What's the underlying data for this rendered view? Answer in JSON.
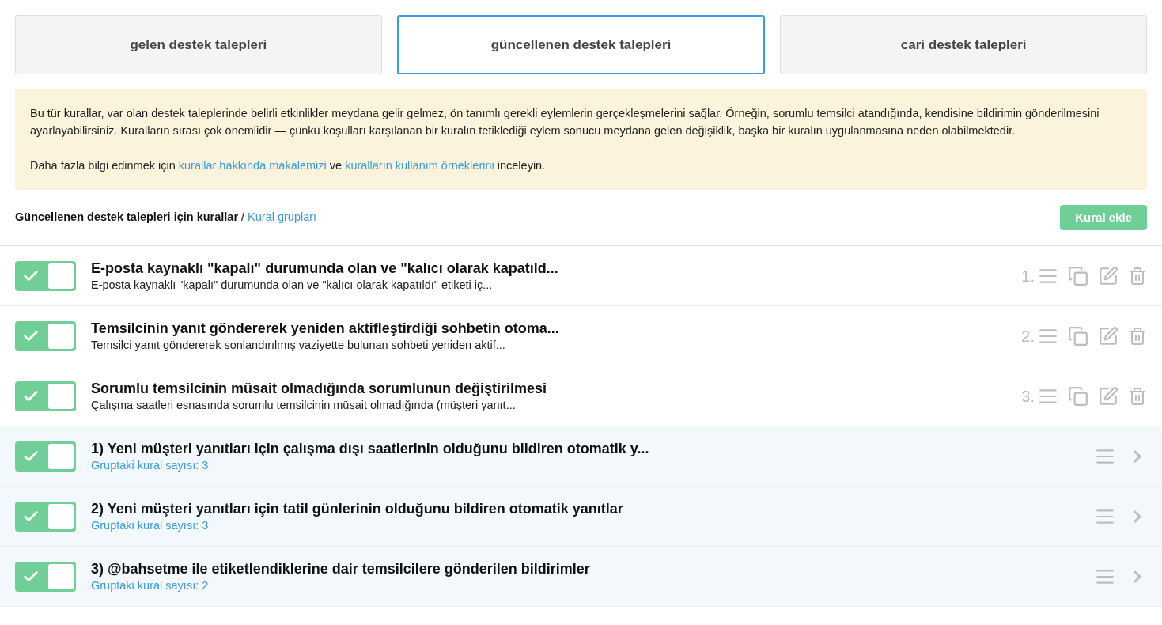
{
  "tabs": [
    {
      "label": "gelen destek talepleri",
      "selected": false
    },
    {
      "label": "güncellenen destek talepleri",
      "selected": true
    },
    {
      "label": "cari destek talepleri",
      "selected": false
    }
  ],
  "notice": {
    "paragraph": "Bu tür kurallar, var olan destek taleplerinde belirli etkinlikler meydana gelir gelmez, ön tanımlı gerekli eylemlerin gerçekleşmelerini sağlar. Örneğin, sorumlu temsilci atandığında, kendisine bildirimin gönderilmesini ayarlayabilirsiniz. Kuralların sırası çok önemlidir — çünkü koşulları karşılanan bir kuralın tetiklediği eylem sonucu meydana gelen değişiklik, başka bir kuralın uygulanmasına neden olabilmektedir.",
    "more": [
      {
        "kind": "text",
        "text": "Daha fazla bilgi edinmek için "
      },
      {
        "kind": "link",
        "text": "kurallar hakkında makalemizi"
      },
      {
        "kind": "text",
        "text": " ve "
      },
      {
        "kind": "link",
        "text": "kuralların kullanım örneklerini"
      },
      {
        "kind": "text",
        "text": " inceleyin."
      }
    ]
  },
  "breadcrumb": {
    "current": "Güncellenen destek talepleri için kurallar",
    "separator": "/",
    "link": "Kural grupları"
  },
  "add_button": "Kural ekle",
  "rules": [
    {
      "kind": "rule",
      "on": true,
      "title": "E-posta kaynaklı \"kapalı\" durumunda olan ve \"kalıcı olarak kapatıld...",
      "subtitle": "E-posta kaynaklı \"kapalı\" durumunda olan ve \"kalıcı olarak kapatıldı\" etiketi iç...",
      "order": "1."
    },
    {
      "kind": "rule",
      "on": true,
      "title": "Temsilcinin yanıt göndererek yeniden aktifleştirdiği sohbetin otoma...",
      "subtitle": "Temsilci yanıt göndererek sonlandırılmış vaziyette bulunan sohbeti yeniden aktif...",
      "order": "2."
    },
    {
      "kind": "rule",
      "on": true,
      "title": "Sorumlu temsilcinin müsait olmadığında sorumlunun değiştirilmesi",
      "subtitle": "Çalışma saatleri esnasında sorumlu temsilcinin müsait olmadığında (müşteri yanıt...",
      "order": "3."
    },
    {
      "kind": "group",
      "on": true,
      "title": "1) Yeni müşteri yanıtları için çalışma dışı saatlerinin olduğunu bildiren otomatik y...",
      "subtitle": "Gruptaki kural sayısı: 3"
    },
    {
      "kind": "group",
      "on": true,
      "title": "2) Yeni müşteri yanıtları için tatil günlerinin olduğunu bildiren otomatik yanıtlar",
      "subtitle": "Gruptaki kural sayısı: 3"
    },
    {
      "kind": "group",
      "on": true,
      "title": "3) @bahsetme ile etiketlendiklerine dair temsilcilere gönderilen bildirimler",
      "subtitle": "Gruptaki kural sayısı: 2"
    }
  ]
}
